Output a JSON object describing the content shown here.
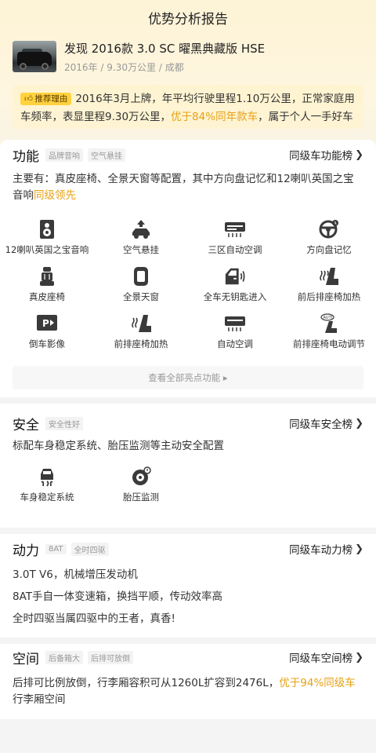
{
  "header": {
    "title": "优势分析报告"
  },
  "car": {
    "title": "发现 2016款 3.0 SC 曜黑典藏版 HSE",
    "year": "2016年",
    "mileage": "9.30万公里",
    "city": "成都",
    "sep": "/"
  },
  "reason": {
    "tag": "推荐理由",
    "text_a": "2016年3月上牌，年平均行驶里程1.10万公里，正常家庭用车频率，表显里程9.30万公里，",
    "highlight": "优于84%同年款车",
    "text_b": "，属于个人一手好车"
  },
  "feature_section": {
    "title": "功能",
    "tags": [
      "品牌音响",
      "空气悬挂"
    ],
    "rank_link": "同级车功能榜",
    "desc": "主要有：真皮座椅、全景天窗等配置，其中方向盘记忆和12喇叭英国之宝音响",
    "desc_highlight": "同级领先",
    "items": [
      {
        "label": "12喇叭英国之宝音响",
        "icon": "speaker-icon"
      },
      {
        "label": "空气悬挂",
        "icon": "air-suspension-icon"
      },
      {
        "label": "三区自动空调",
        "icon": "ac-unit-icon"
      },
      {
        "label": "方向盘记忆",
        "icon": "steering-wheel-icon"
      },
      {
        "label": "真皮座椅",
        "icon": "leather-seat-icon"
      },
      {
        "label": "全景天窗",
        "icon": "sunroof-icon"
      },
      {
        "label": "全车无钥匙进入",
        "icon": "keyless-door-icon"
      },
      {
        "label": "前后排座椅加热",
        "icon": "seat-heat-icon"
      },
      {
        "label": "倒车影像",
        "icon": "parking-camera-icon"
      },
      {
        "label": "前排座椅加热",
        "icon": "front-seat-heat-icon"
      },
      {
        "label": "自动空调",
        "icon": "auto-ac-icon"
      },
      {
        "label": "前排座椅电动调节",
        "icon": "power-seat-icon"
      }
    ],
    "view_all": "查看全部亮点功能 ▸"
  },
  "safety_section": {
    "title": "安全",
    "tags": [
      "安全性好"
    ],
    "rank_link": "同级车安全榜",
    "desc": "标配车身稳定系统、胎压监测等主动安全配置",
    "items": [
      {
        "label": "车身稳定系统",
        "icon": "stability-control-icon"
      },
      {
        "label": "胎压监测",
        "icon": "tire-pressure-icon"
      }
    ]
  },
  "power_section": {
    "title": "动力",
    "tags": [
      "8AT",
      "全时四驱"
    ],
    "rank_link": "同级车动力榜",
    "lines": [
      "3.0T V6，机械增压发动机",
      "8AT手自一体变速箱，换挡平顺，传动效率高",
      "全时四驱当属四驱中的王者，真香!"
    ]
  },
  "space_section": {
    "title": "空间",
    "tags": [
      "后备箱大",
      "后排可放倒"
    ],
    "rank_link": "同级车空间榜",
    "desc": "后排可比例放倒，行李厢容积可从1260L扩容到2476L，",
    "desc_highlight": "优于94%同级车",
    "desc_tail": "行李厢空间"
  },
  "colors": {
    "accent": "#e6a115",
    "tag_yellow": "#ffd23e",
    "banner_bg": "#fdf3d6"
  }
}
